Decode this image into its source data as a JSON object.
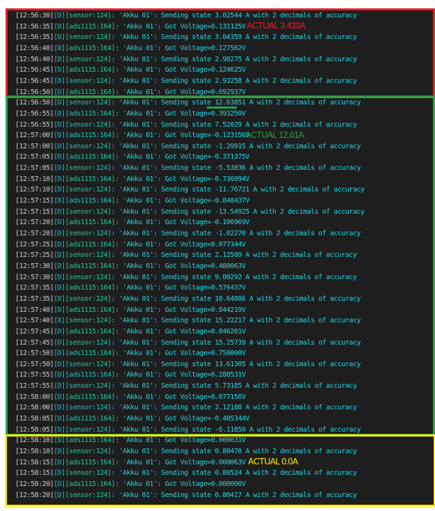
{
  "log_lines": [
    {
      "time": "[12:56:30]",
      "level": "[D]",
      "tag": "[sensor:124]",
      "msg": ": 'Akku 01': Sending state 3.02544 A with 2 decimals of accuracy"
    },
    {
      "time": "[12:56:35]",
      "level": "[D]",
      "tag": "[ads1115:164]",
      "msg": ": 'Akku 01': Got Voltage=0.131125V"
    },
    {
      "time": "[12:56:35]",
      "level": "[D]",
      "tag": "[sensor:124]",
      "msg": ": 'Akku 01': Sending state 3.04359 A with 2 decimals of accuracy"
    },
    {
      "time": "[12:56:40]",
      "level": "[D]",
      "tag": "[ads1115:164]",
      "msg": ": 'Akku 01': Got Voltage=0.127562V"
    },
    {
      "time": "[12:56:40]",
      "level": "[D]",
      "tag": "[sensor:124]",
      "msg": ": 'Akku 01': Sending state 2.98275 A with 2 decimals of accuracy"
    },
    {
      "time": "[12:56:45]",
      "level": "[D]",
      "tag": "[ads1115:164]",
      "msg": ": 'Akku 01': Got Voltage=0.124625V"
    },
    {
      "time": "[12:56:45]",
      "level": "[D]",
      "tag": "[sensor:124]",
      "msg": ": 'Akku 01': Sending state 2.93258 A with 2 decimals of accuracy"
    },
    {
      "time": "[12:56:50]",
      "level": "[D]",
      "tag": "[ads1115:164]",
      "msg": ": 'Akku 01': Got Voltage=0.692937V"
    },
    {
      "time": "[12:56:50]",
      "level": "[D]",
      "tag": "[sensor:124]",
      "msg": ": 'Akku 01': Sending state 12.63851 A with 2 decimals of accuracy"
    },
    {
      "time": "[12:56:55]",
      "level": "[D]",
      "tag": "[ads1115:164]",
      "msg": ": 'Akku 01': Got Voltage=0.393250V"
    },
    {
      "time": "[12:56:55]",
      "level": "[D]",
      "tag": "[sensor:124]",
      "msg": ": 'Akku 01': Sending state 7.52029 A with 2 decimals of accuracy"
    },
    {
      "time": "[12:57:00]",
      "level": "[D]",
      "tag": "[ads1115:164]",
      "msg": ": 'Akku 01': Got Voltage=-0.123156V"
    },
    {
      "time": "[12:57:00]",
      "level": "[D]",
      "tag": "[sensor:124]",
      "msg": ": 'Akku 01': Sending state -1.29915 A with 2 decimals of accuracy"
    },
    {
      "time": "[12:57:05]",
      "level": "[D]",
      "tag": "[ads1115:164]",
      "msg": ": 'Akku 01': Got Voltage=-0.371375V"
    },
    {
      "time": "[12:57:05]",
      "level": "[D]",
      "tag": "[sensor:124]",
      "msg": ": 'Akku 01': Sending state -5.53836 A with 2 decimals of accuracy"
    },
    {
      "time": "[12:57:10]",
      "level": "[D]",
      "tag": "[ads1115:164]",
      "msg": ": 'Akku 01': Got Voltage=-0.736094V"
    },
    {
      "time": "[12:57:10]",
      "level": "[D]",
      "tag": "[sensor:124]",
      "msg": ": 'Akku 01': Sending state -11.76721 A with 2 decimals of accuracy"
    },
    {
      "time": "[12:57:15]",
      "level": "[D]",
      "tag": "[ads1115:164]",
      "msg": ": 'Akku 01': Got Voltage=-0.840437V"
    },
    {
      "time": "[12:57:15]",
      "level": "[D]",
      "tag": "[sensor:124]",
      "msg": ": 'Akku 01': Sending state -13.54925 A with 2 decimals of accuracy"
    },
    {
      "time": "[12:57:20]",
      "level": "[D]",
      "tag": "[ads1115:164]",
      "msg": ": 'Akku 01': Got Voltage=-0.106969V"
    },
    {
      "time": "[12:57:20]",
      "level": "[D]",
      "tag": "[sensor:124]",
      "msg": ": 'Akku 01': Sending state -1.02270 A with 2 decimals of accuracy"
    },
    {
      "time": "[12:57:25]",
      "level": "[D]",
      "tag": "[ads1115:164]",
      "msg": ": 'Akku 01': Got Voltage=0.077344V"
    },
    {
      "time": "[12:57:25]",
      "level": "[D]",
      "tag": "[sensor:124]",
      "msg": ": 'Akku 01': Sending state 2.12509 A with 2 decimals of accuracy"
    },
    {
      "time": "[12:57:30]",
      "level": "[D]",
      "tag": "[ads1115:164]",
      "msg": ": 'Akku 01': Got Voltage=0.480063V"
    },
    {
      "time": "[12:57:30]",
      "level": "[D]",
      "tag": "[sensor:124]",
      "msg": ": 'Akku 01': Sending state 9.00292 A with 2 decimals of accuracy"
    },
    {
      "time": "[12:57:35]",
      "level": "[D]",
      "tag": "[ads1115:164]",
      "msg": ": 'Akku 01': Got Voltage=0.576437V"
    },
    {
      "time": "[12:57:35]",
      "level": "[D]",
      "tag": "[sensor:124]",
      "msg": ": 'Akku 01': Sending state 10.64886 A with 2 decimals of accuracy"
    },
    {
      "time": "[12:57:40]",
      "level": "[D]",
      "tag": "[ads1115:164]",
      "msg": ": 'Akku 01': Got Voltage=0.844219V"
    },
    {
      "time": "[12:57:40]",
      "level": "[D]",
      "tag": "[sensor:124]",
      "msg": ": 'Akku 01': Sending state 15.22217 A with 2 decimals of accuracy"
    },
    {
      "time": "[12:57:45]",
      "level": "[D]",
      "tag": "[ads1115:164]",
      "msg": ": 'Akku 01': Got Voltage=0.846281V"
    },
    {
      "time": "[12:57:45]",
      "level": "[D]",
      "tag": "[sensor:124]",
      "msg": ": 'Akku 01': Sending state 15.25739 A with 2 decimals of accuracy"
    },
    {
      "time": "[12:57:50]",
      "level": "[D]",
      "tag": "[ads1115:164]",
      "msg": ": 'Akku 01': Got Voltage=0.750000V"
    },
    {
      "time": "[12:57:50]",
      "level": "[D]",
      "tag": "[sensor:124]",
      "msg": ": 'Akku 01': Sending state 13.61305 A with 2 decimals of accuracy"
    },
    {
      "time": "[12:57:55]",
      "level": "[D]",
      "tag": "[ads1115:164]",
      "msg": ": 'Akku 01': Got Voltage=0.288531V"
    },
    {
      "time": "[12:57:55]",
      "level": "[D]",
      "tag": "[sensor:124]",
      "msg": ": 'Akku 01': Sending state 5.73185 A with 2 decimals of accuracy"
    },
    {
      "time": "[12:58:00]",
      "level": "[D]",
      "tag": "[ads1115:164]",
      "msg": ": 'Akku 01': Got Voltage=0.077156V"
    },
    {
      "time": "[12:58:00]",
      "level": "[D]",
      "tag": "[sensor:124]",
      "msg": ": 'Akku 01': Sending state 2.12188 A with 2 decimals of accuracy"
    },
    {
      "time": "[12:58:05]",
      "level": "[D]",
      "tag": "[ads1115:164]",
      "msg": ": 'Akku 01': Got Voltage=-0.405344V"
    },
    {
      "time": "[12:58:05]",
      "level": "[D]",
      "tag": "[sensor:124]",
      "msg": ": 'Akku 01': Sending state -6.11850 A with 2 decimals of accuracy"
    },
    {
      "time": "[12:58:10]",
      "level": "[D]",
      "tag": "[ads1115:164]",
      "msg": ": 'Akku 01': Got Voltage=0.000031V"
    },
    {
      "time": "[12:58:10]",
      "level": "[D]",
      "tag": "[sensor:124]",
      "msg": ": 'Akku 01': Sending state 0.80470 A with 2 decimals of accuracy"
    },
    {
      "time": "[12:58:15]",
      "level": "[D]",
      "tag": "[ads1115:164]",
      "msg": ": 'Akku 01': Got Voltage=0.000063V"
    },
    {
      "time": "[12:58:15]",
      "level": "[D]",
      "tag": "[sensor:124]",
      "msg": ": 'Akku 01': Sending state 0.80524 A with 2 decimals of accuracy"
    },
    {
      "time": "[12:58:20]",
      "level": "[D]",
      "tag": "[ads1115:164]",
      "msg": ": 'Akku 01': Got Voltage=0.000000V"
    },
    {
      "time": "[12:58:20]",
      "level": "[D]",
      "tag": "[sensor:124]",
      "msg": ": 'Akku 01': Sending state 0.80417 A with 2 decimals of accuracy"
    }
  ],
  "annotations": {
    "red": {
      "text": "ACTUAL 3.433A",
      "color": "#e5202a"
    },
    "green": {
      "text": "ACTUAL 12.61A",
      "color": "#2e9d45"
    },
    "yellow": {
      "text": "ACTUAL 0.0A",
      "color": "#ffee00"
    }
  }
}
